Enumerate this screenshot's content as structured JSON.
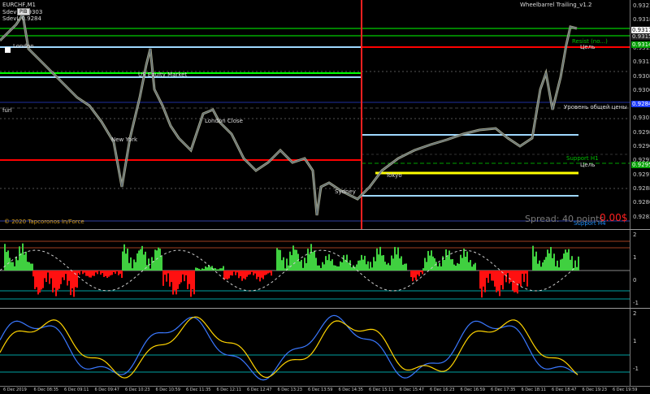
{
  "symbol": "EURCHF,M1",
  "indicator_title": "Wheelbarrel Trailing_v1.2",
  "info": {
    "sdev_h": "SdevH 1.9303",
    "sdev_l": "SdevL 0.9284",
    "box_label": "PIB",
    "rs": "RS"
  },
  "price_axis": [
    "0.93210",
    "0.93185",
    "0.93160",
    "0.93135",
    "0.93110",
    "0.93085",
    "0.93060",
    "0.93035",
    "0.93010",
    "0.92985",
    "0.92960",
    "0.92935",
    "0.92910",
    "0.92885",
    "0.92860",
    "0.92835"
  ],
  "price_tags": {
    "current": "0.93172",
    "bid": "0.93156",
    "res": "0.93149",
    "support": "0.92958",
    "blue": "0.92840"
  },
  "session_labels": {
    "london": "London",
    "us_equity": "US Equity Market",
    "new_york": "New York",
    "london_close": "London Close",
    "tokyo": "Tokyo",
    "sydney": "Sydney",
    "furl": "furl"
  },
  "levels": {
    "target_top": "Цель",
    "target_bottom": "Цель",
    "common_price": "Уровень общей цены",
    "support_h1": "Support H1",
    "support_h4": "Support H4",
    "hint": "Resist (no...)"
  },
  "spread": "Spread: 40 points",
  "spread_value": "0.00$",
  "copyright": "© 2020 Tapcoronos In/Force",
  "osc1_axis": [
    "2",
    "1",
    "0",
    "-1"
  ],
  "osc2_axis": [
    "2",
    "1",
    "-1"
  ],
  "x_axis": [
    "6 Dec 2019",
    "6 Dec 08:35",
    "6 Dec 09:11",
    "6 Dec 09:47",
    "6 Dec 10:23",
    "6 Dec 10:59",
    "6 Dec 11:35",
    "6 Dec 12:11",
    "6 Dec 12:47",
    "6 Dec 13:23",
    "6 Dec 13:59",
    "6 Dec 14:35",
    "6 Dec 15:11",
    "6 Dec 15:47",
    "6 Dec 16:23",
    "6 Dec 16:59",
    "6 Dec 17:35",
    "6 Dec 18:11",
    "6 Dec 18:47",
    "6 Dec 19:23",
    "6 Dec 19:59"
  ],
  "colors": {
    "candle": "#b6b89a",
    "green": "#00ff00",
    "red": "#ff0000",
    "blue": "#1e3cff",
    "lightblue": "#9fd8ff",
    "yellow": "#ffff00",
    "teal": "#00a0a0"
  }
}
